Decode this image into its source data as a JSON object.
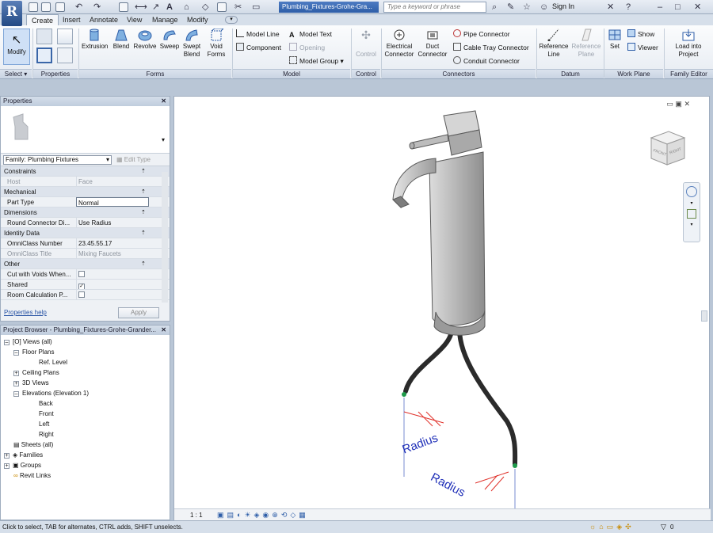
{
  "window": {
    "app_logo": "R",
    "file_name": "Plumbing_Fixtures-Grohe-Gra...",
    "search_placeholder": "Type a keyword or phrase",
    "sign_in": "Sign In"
  },
  "tabs": [
    "Create",
    "Insert",
    "Annotate",
    "View",
    "Manage",
    "Modify"
  ],
  "active_tab": "Create",
  "ribbon": {
    "select": {
      "modify": "Modify",
      "title": "Select ▾"
    },
    "properties": {
      "title": "Properties"
    },
    "forms": {
      "title": "Forms",
      "extrusion": "Extrusion",
      "blend": "Blend",
      "revolve": "Revolve",
      "sweep": "Sweep",
      "swept_blend_1": "Swept",
      "swept_blend_2": "Blend",
      "void_1": "Void",
      "void_2": "Forms"
    },
    "model": {
      "title": "Model",
      "model_line": "Model Line",
      "model_text": "Model Text",
      "component": "Component",
      "opening": "Opening",
      "model_group": "Model Group"
    },
    "control": {
      "title": "Control",
      "control": "Control"
    },
    "connectors": {
      "title": "Connectors",
      "electrical_1": "Electrical",
      "electrical_2": "Connector",
      "duct_1": "Duct",
      "duct_2": "Connector",
      "pipe": "Pipe Connector",
      "cable_tray": "Cable Tray Connector",
      "conduit": "Conduit Connector"
    },
    "datum": {
      "title": "Datum",
      "ref_line_1": "Reference",
      "ref_line_2": "Line",
      "ref_plane_1": "Reference",
      "ref_plane_2": "Plane"
    },
    "work_plane": {
      "title": "Work Plane",
      "set": "Set",
      "show": "Show",
      "viewer": "Viewer"
    },
    "family_editor": {
      "title": "Family Editor",
      "load_1": "Load into",
      "load_2": "Project"
    }
  },
  "properties": {
    "title": "Properties",
    "type_selector": "Family: Plumbing Fixtures",
    "edit_type": "Edit Type",
    "rows": [
      {
        "cat": true,
        "k": "Constraints"
      },
      {
        "k": "Host",
        "v": "Face",
        "grey": true
      },
      {
        "cat": true,
        "k": "Mechanical"
      },
      {
        "k": "Part Type",
        "v": "Normal",
        "boxed": true
      },
      {
        "cat": true,
        "k": "Dimensions"
      },
      {
        "k": "Round Connector Di...",
        "v": "Use Radius"
      },
      {
        "cat": true,
        "k": "Identity Data"
      },
      {
        "k": "OmniClass Number",
        "v": "23.45.55.17"
      },
      {
        "k": "OmniClass Title",
        "v": "Mixing Faucets",
        "grey": true
      },
      {
        "cat": true,
        "k": "Other"
      },
      {
        "k": "Cut with Voids When...",
        "check": false
      },
      {
        "k": "Shared",
        "check": true
      },
      {
        "k": "Room Calculation P...",
        "check": false
      }
    ],
    "help": "Properties help",
    "apply": "Apply"
  },
  "browser": {
    "title": "Project Browser - Plumbing_Fixtures-Grohe-Grander...",
    "views_all": "Views (all)",
    "floor_plans": "Floor Plans",
    "ref_level": "Ref. Level",
    "ceiling_plans": "Ceiling Plans",
    "views_3d": "3D Views",
    "elevations": "Elevations (Elevation 1)",
    "back": "Back",
    "front": "Front",
    "left": "Left",
    "right": "Right",
    "sheets": "Sheets (all)",
    "families": "Families",
    "groups": "Groups",
    "revit_links": "Revit Links"
  },
  "canvas": {
    "dim_label_1": "Radius",
    "dim_label_2": "Radius",
    "view_scale": "1 : 1",
    "viewcube_front": "FRONT",
    "viewcube_right": "RIGHT"
  },
  "status": {
    "hint": "Click to select, TAB for alternates, CTRL adds, SHIFT unselects.",
    "filter_count": "0"
  },
  "colors": {
    "accent": "#2e5ea8",
    "dimension_text": "#1f2fb8",
    "dimension_ticks": "#e0312a",
    "connector_green": "#1f9a4a"
  }
}
